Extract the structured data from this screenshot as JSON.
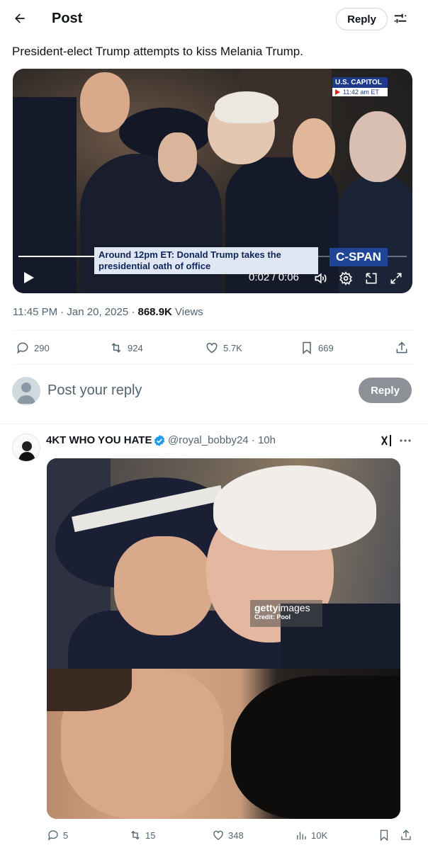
{
  "header": {
    "title": "Post",
    "reply_label": "Reply",
    "back_icon": "arrow-left-icon",
    "filter_icon": "sliders-icon"
  },
  "post": {
    "text": "President-elect Trump attempts to kiss Melania Trump.",
    "video": {
      "badge_title": "U.S. CAPITOL",
      "badge_time": "11:42 am ET",
      "lower_third": "Around 12pm ET: Donald Trump takes the presidential oath of office",
      "network": "C-SPAN",
      "time_display": "0:02 / 0:06",
      "progress": 0.33
    },
    "timestamp": "11:45 PM · Jan 20, 2025 · ",
    "views_count": "868.9K",
    "views_label": " Views",
    "stats": {
      "replies": "290",
      "reposts": "924",
      "likes": "5.7K",
      "bookmarks": "669"
    }
  },
  "reply_box": {
    "placeholder": "Post your reply",
    "button": "Reply"
  },
  "comment": {
    "name": "4KT WHO YOU HATE",
    "handle": "@royal_bobby24 · 10h",
    "image": {
      "watermark_brand_a": "getty",
      "watermark_brand_b": "images",
      "watermark_credit": "Credit: Pool"
    },
    "stats": {
      "replies": "5",
      "reposts": "15",
      "likes": "348",
      "views": "10K"
    }
  },
  "colors": {
    "accent_verified": "#1d9bf0",
    "text_secondary": "#536471",
    "cspan_blue": "#1f4696"
  }
}
